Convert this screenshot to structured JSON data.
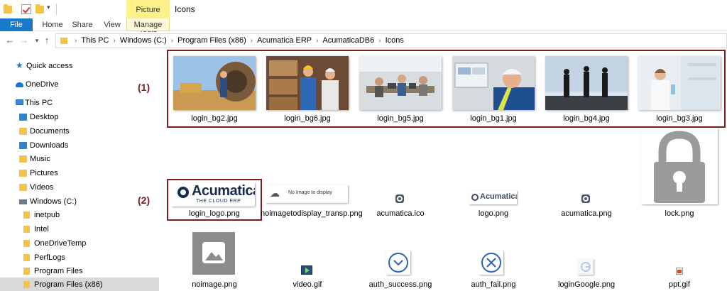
{
  "window": {
    "title": "Icons",
    "context_tab": "Picture Tools"
  },
  "ribbon": {
    "tabs": [
      "File",
      "Home",
      "Share",
      "View",
      "Manage"
    ]
  },
  "address": {
    "crumbs": [
      "This PC",
      "Windows (C:)",
      "Program Files (x86)",
      "Acumatica ERP",
      "AcumaticaDB6",
      "Icons"
    ]
  },
  "nav": {
    "items": [
      {
        "label": "Quick access"
      },
      {
        "label": "OneDrive"
      },
      {
        "label": "This PC"
      },
      {
        "label": "Desktop"
      },
      {
        "label": "Documents"
      },
      {
        "label": "Downloads"
      },
      {
        "label": "Music"
      },
      {
        "label": "Pictures"
      },
      {
        "label": "Videos"
      },
      {
        "label": "Windows (C:)"
      },
      {
        "label": "inetpub"
      },
      {
        "label": "Intel"
      },
      {
        "label": "OneDriveTemp"
      },
      {
        "label": "PerfLogs"
      },
      {
        "label": "Program Files"
      },
      {
        "label": "Program Files (x86)"
      }
    ]
  },
  "markers": {
    "one": "(1)",
    "two": "(2)"
  },
  "files": {
    "row1": [
      "login_bg2.jpg",
      "login_bg6.jpg",
      "login_bg5.jpg",
      "login_bg1.jpg",
      "login_bg4.jpg",
      "login_bg3.jpg"
    ],
    "row2": [
      "login_logo.png",
      "noimagetodisplay_transp.png",
      "acumatica.ico",
      "logo.png",
      "acumatica.png",
      "lock.png"
    ],
    "row3": [
      "noimage.png",
      "video.gif",
      "auth_success.png",
      "auth_fail.png",
      "loginGoogle.png",
      "ppt.gif"
    ]
  },
  "thumb_text": {
    "acumatica": "Acumatica",
    "cloud_erp": "THE CLOUD ERP",
    "no_image": "No Image to display"
  },
  "colors": {
    "accent": "#1979ca",
    "highlight_border": "#7b1e24",
    "context_tab": "#fdf28a"
  }
}
